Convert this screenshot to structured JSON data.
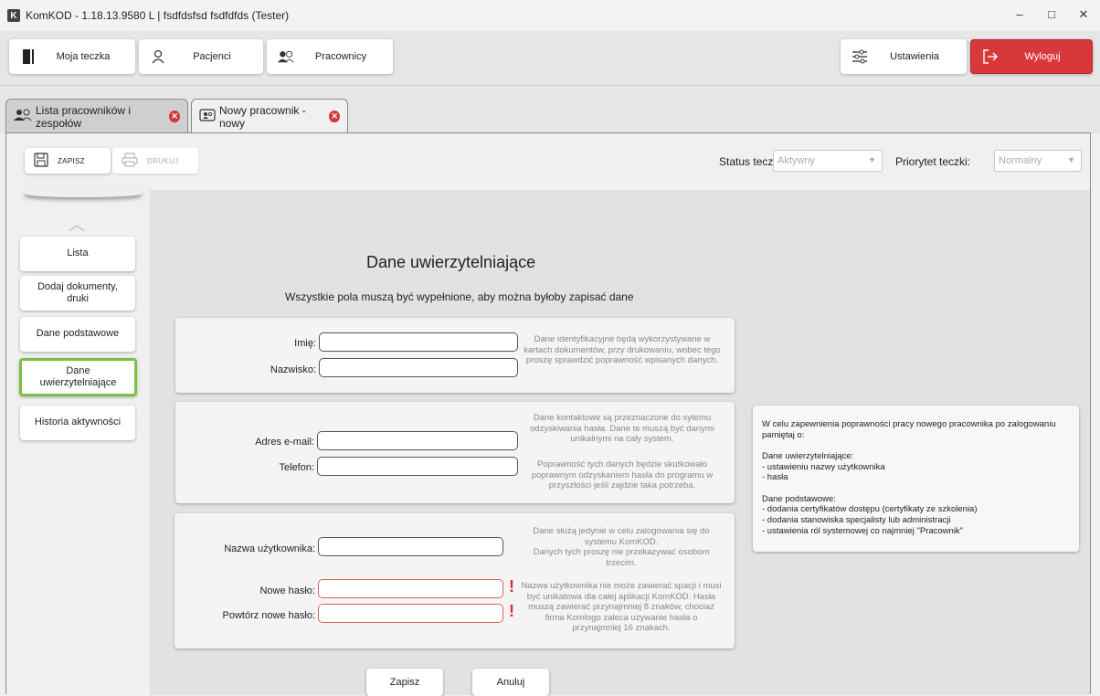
{
  "window": {
    "logo": "K",
    "title": "KomKOD - 1.18.13.9580 L | fsdfdsfsd fsdfdfds (Tester)"
  },
  "nav": {
    "folder": "Moja teczka",
    "patients": "Pacjenci",
    "staff": "Pracownicy",
    "settings": "Ustawienia",
    "logout": "Wyloguj"
  },
  "tabs": {
    "list": "Lista pracowników i zespołów",
    "new_worker": "Nowy pracownik - nowy"
  },
  "toolbar": {
    "save": "ZAPISZ",
    "print": "DRUKUJ",
    "status_label": "Status teczki",
    "status_value": "Aktywny",
    "priority_label": "Priorytet teczki:",
    "priority_value": "Normalny"
  },
  "sidebar": {
    "items": [
      "Lista",
      "Dodaj dokumenty, druki",
      "Dane podstawowe",
      "Dane uwierzytelniające",
      "Historia aktywności"
    ],
    "active": "Dane uwierzytelniające"
  },
  "form": {
    "title": "Dane uwierzytelniające",
    "subtitle": "Wszystkie pola muszą być wypełnione, aby można byłoby zapisać dane",
    "first_name_label": "Imię:",
    "last_name_label": "Nazwisko:",
    "identity_hint": "Dane identyfikacyjne będą wykorzystywane w kartach dokumentów, przy drukowaniu, wobec tego proszę sprawdzić poprawność wpisanych danych.",
    "email_label": "Adres e-mail:",
    "phone_label": "Telefon:",
    "contact_hint_1": "Dane kontaktowe są przeznaczone do sytemu odzyskiwania hasła. Dane te muszą być danymi unikalnymi na cały system.",
    "contact_hint_2": "Poprawność tych danych będzie skutkowało poprawnym odzyskaniem hasła do programu w przyszłości jeśli zajdzie taka potrzeba.",
    "username_label": "Nazwa użytkownika:",
    "new_password_label": "Nowe hasło:",
    "repeat_password_label": "Powtórz nowe hasło:",
    "error_mark": "!",
    "login_hint_1": "Dane służą jedynie w celu zalogowania się do systemu KomKOD.\nDanych tych proszę nie przekazywać osobom trzecim.",
    "login_hint_2": "Nazwa użytkownika nie może zawierać spacji i musi być unikatowa dla całej aplikacji KomKOD. Hasła muszą zawierać przynajmniej 8 znaków, chociaż firma Komlogo zaleca używanie hasła o przynajmniej 16 znakach.",
    "save_button": "Zapisz",
    "cancel_button": "Anuluj"
  },
  "info": {
    "intro": "W celu zapewnienia poprawności pracy nowego pracownika po zalogowaniu pamiętaj o:",
    "auth_section": "Dane uwierzytelniające:\n- ustawieniu nazwy użytkownika\n- hasła",
    "basic_section": "Dane podstawowe:\n- dodania certyfikatów dostępu (certyfikaty ze szkolenia)\n- dodania stanowiska specjalisty lub administracji\n- ustawienia ról systemowej co najmniej \"Pracownik\""
  }
}
